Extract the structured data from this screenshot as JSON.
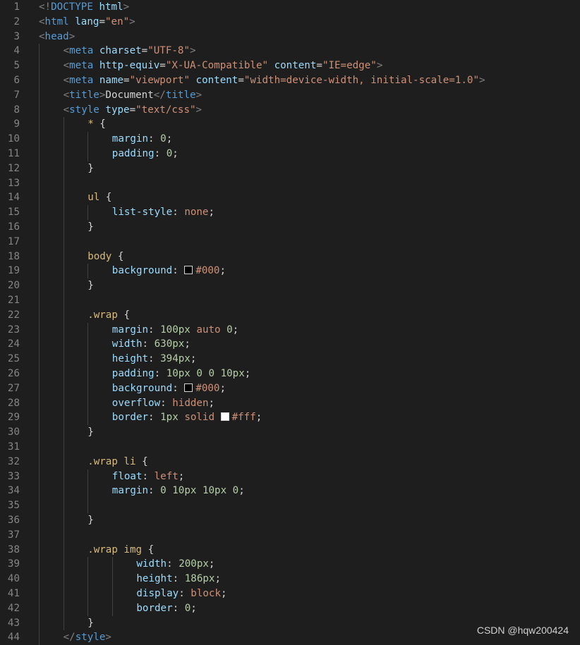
{
  "editor": {
    "lines": [
      {
        "n": "1",
        "indent": 0,
        "tokens": [
          [
            "punct",
            "<!"
          ],
          [
            "tag",
            "DOCTYPE"
          ],
          [
            "text",
            " "
          ],
          [
            "attr",
            "html"
          ],
          [
            "punct",
            ">"
          ]
        ]
      },
      {
        "n": "2",
        "indent": 0,
        "tokens": [
          [
            "punct",
            "<"
          ],
          [
            "tag",
            "html"
          ],
          [
            "text",
            " "
          ],
          [
            "attr",
            "lang"
          ],
          [
            "text",
            "="
          ],
          [
            "str",
            "\"en\""
          ],
          [
            "punct",
            ">"
          ]
        ]
      },
      {
        "n": "3",
        "indent": 0,
        "tokens": [
          [
            "punct",
            "<"
          ],
          [
            "tag",
            "head"
          ],
          [
            "punct",
            ">"
          ]
        ]
      },
      {
        "n": "4",
        "indent": 1,
        "tokens": [
          [
            "punct",
            "<"
          ],
          [
            "tag",
            "meta"
          ],
          [
            "text",
            " "
          ],
          [
            "attr",
            "charset"
          ],
          [
            "text",
            "="
          ],
          [
            "str",
            "\"UTF-8\""
          ],
          [
            "punct",
            ">"
          ]
        ]
      },
      {
        "n": "5",
        "indent": 1,
        "tokens": [
          [
            "punct",
            "<"
          ],
          [
            "tag",
            "meta"
          ],
          [
            "text",
            " "
          ],
          [
            "attr",
            "http-equiv"
          ],
          [
            "text",
            "="
          ],
          [
            "str",
            "\"X-UA-Compatible\""
          ],
          [
            "text",
            " "
          ],
          [
            "attr",
            "content"
          ],
          [
            "text",
            "="
          ],
          [
            "str",
            "\"IE=edge\""
          ],
          [
            "punct",
            ">"
          ]
        ]
      },
      {
        "n": "6",
        "indent": 1,
        "tokens": [
          [
            "punct",
            "<"
          ],
          [
            "tag",
            "meta"
          ],
          [
            "text",
            " "
          ],
          [
            "attr",
            "name"
          ],
          [
            "text",
            "="
          ],
          [
            "str",
            "\"viewport\""
          ],
          [
            "text",
            " "
          ],
          [
            "attr",
            "content"
          ],
          [
            "text",
            "="
          ],
          [
            "str",
            "\"width=device-width, initial-scale=1.0\""
          ],
          [
            "punct",
            ">"
          ]
        ]
      },
      {
        "n": "7",
        "indent": 1,
        "tokens": [
          [
            "punct",
            "<"
          ],
          [
            "tag",
            "title"
          ],
          [
            "punct",
            ">"
          ],
          [
            "text",
            "Document"
          ],
          [
            "punct",
            "</"
          ],
          [
            "tag",
            "title"
          ],
          [
            "punct",
            ">"
          ]
        ]
      },
      {
        "n": "8",
        "indent": 1,
        "tokens": [
          [
            "punct",
            "<"
          ],
          [
            "tag",
            "style"
          ],
          [
            "text",
            " "
          ],
          [
            "attr",
            "type"
          ],
          [
            "text",
            "="
          ],
          [
            "str",
            "\"text/css\""
          ],
          [
            "punct",
            ">"
          ]
        ]
      },
      {
        "n": "9",
        "indent": 2,
        "tokens": [
          [
            "sel",
            "*"
          ],
          [
            "text",
            " {"
          ]
        ]
      },
      {
        "n": "10",
        "indent": 3,
        "tokens": [
          [
            "prop",
            "margin"
          ],
          [
            "text",
            ": "
          ],
          [
            "num",
            "0"
          ],
          [
            "text",
            ";"
          ]
        ]
      },
      {
        "n": "11",
        "indent": 3,
        "tokens": [
          [
            "prop",
            "padding"
          ],
          [
            "text",
            ": "
          ],
          [
            "num",
            "0"
          ],
          [
            "text",
            ";"
          ]
        ]
      },
      {
        "n": "12",
        "indent": 2,
        "tokens": [
          [
            "text",
            "}"
          ]
        ]
      },
      {
        "n": "13",
        "indent": 0,
        "tokens": []
      },
      {
        "n": "14",
        "indent": 2,
        "tokens": [
          [
            "sel",
            "ul"
          ],
          [
            "text",
            " {"
          ]
        ]
      },
      {
        "n": "15",
        "indent": 3,
        "tokens": [
          [
            "prop",
            "list-style"
          ],
          [
            "text",
            ": "
          ],
          [
            "kw",
            "none"
          ],
          [
            "text",
            ";"
          ]
        ]
      },
      {
        "n": "16",
        "indent": 2,
        "tokens": [
          [
            "text",
            "}"
          ]
        ]
      },
      {
        "n": "17",
        "indent": 0,
        "tokens": []
      },
      {
        "n": "18",
        "indent": 2,
        "tokens": [
          [
            "sel",
            "body"
          ],
          [
            "text",
            " {"
          ]
        ]
      },
      {
        "n": "19",
        "indent": 3,
        "tokens": [
          [
            "prop",
            "background"
          ],
          [
            "text",
            ": "
          ],
          [
            "swatch",
            "#000000"
          ],
          [
            "kw",
            "#000"
          ],
          [
            "text",
            ";"
          ]
        ]
      },
      {
        "n": "20",
        "indent": 2,
        "tokens": [
          [
            "text",
            "}"
          ]
        ]
      },
      {
        "n": "21",
        "indent": 0,
        "tokens": []
      },
      {
        "n": "22",
        "indent": 2,
        "tokens": [
          [
            "sel",
            ".wrap"
          ],
          [
            "text",
            " {"
          ]
        ]
      },
      {
        "n": "23",
        "indent": 3,
        "tokens": [
          [
            "prop",
            "margin"
          ],
          [
            "text",
            ": "
          ],
          [
            "num",
            "100px"
          ],
          [
            "text",
            " "
          ],
          [
            "kw",
            "auto"
          ],
          [
            "text",
            " "
          ],
          [
            "num",
            "0"
          ],
          [
            "text",
            ";"
          ]
        ]
      },
      {
        "n": "24",
        "indent": 3,
        "tokens": [
          [
            "prop",
            "width"
          ],
          [
            "text",
            ": "
          ],
          [
            "num",
            "630px"
          ],
          [
            "text",
            ";"
          ]
        ]
      },
      {
        "n": "25",
        "indent": 3,
        "tokens": [
          [
            "prop",
            "height"
          ],
          [
            "text",
            ": "
          ],
          [
            "num",
            "394px"
          ],
          [
            "text",
            ";"
          ]
        ]
      },
      {
        "n": "26",
        "indent": 3,
        "tokens": [
          [
            "prop",
            "padding"
          ],
          [
            "text",
            ": "
          ],
          [
            "num",
            "10px"
          ],
          [
            "text",
            " "
          ],
          [
            "num",
            "0"
          ],
          [
            "text",
            " "
          ],
          [
            "num",
            "0"
          ],
          [
            "text",
            " "
          ],
          [
            "num",
            "10px"
          ],
          [
            "text",
            ";"
          ]
        ]
      },
      {
        "n": "27",
        "indent": 3,
        "tokens": [
          [
            "prop",
            "background"
          ],
          [
            "text",
            ": "
          ],
          [
            "swatch",
            "#000000"
          ],
          [
            "kw",
            "#000"
          ],
          [
            "text",
            ";"
          ]
        ]
      },
      {
        "n": "28",
        "indent": 3,
        "tokens": [
          [
            "prop",
            "overflow"
          ],
          [
            "text",
            ": "
          ],
          [
            "kw",
            "hidden"
          ],
          [
            "text",
            ";"
          ]
        ]
      },
      {
        "n": "29",
        "indent": 3,
        "tokens": [
          [
            "prop",
            "border"
          ],
          [
            "text",
            ": "
          ],
          [
            "num",
            "1px"
          ],
          [
            "text",
            " "
          ],
          [
            "kw",
            "solid"
          ],
          [
            "text",
            " "
          ],
          [
            "swatch",
            "#ffffff"
          ],
          [
            "kw",
            "#fff"
          ],
          [
            "text",
            ";"
          ]
        ]
      },
      {
        "n": "30",
        "indent": 2,
        "tokens": [
          [
            "text",
            "}"
          ]
        ]
      },
      {
        "n": "31",
        "indent": 0,
        "tokens": []
      },
      {
        "n": "32",
        "indent": 2,
        "tokens": [
          [
            "sel",
            ".wrap li"
          ],
          [
            "text",
            " {"
          ]
        ]
      },
      {
        "n": "33",
        "indent": 3,
        "tokens": [
          [
            "prop",
            "float"
          ],
          [
            "text",
            ": "
          ],
          [
            "kw",
            "left"
          ],
          [
            "text",
            ";"
          ]
        ]
      },
      {
        "n": "34",
        "indent": 3,
        "tokens": [
          [
            "prop",
            "margin"
          ],
          [
            "text",
            ": "
          ],
          [
            "num",
            "0"
          ],
          [
            "text",
            " "
          ],
          [
            "num",
            "10px"
          ],
          [
            "text",
            " "
          ],
          [
            "num",
            "10px"
          ],
          [
            "text",
            " "
          ],
          [
            "num",
            "0"
          ],
          [
            "text",
            ";"
          ]
        ]
      },
      {
        "n": "35",
        "indent": 3,
        "tokens": []
      },
      {
        "n": "36",
        "indent": 2,
        "tokens": [
          [
            "text",
            "}"
          ]
        ]
      },
      {
        "n": "37",
        "indent": 0,
        "tokens": []
      },
      {
        "n": "38",
        "indent": 2,
        "tokens": [
          [
            "sel",
            ".wrap img"
          ],
          [
            "text",
            " {"
          ]
        ]
      },
      {
        "n": "39",
        "indent": 4,
        "tokens": [
          [
            "prop",
            "width"
          ],
          [
            "text",
            ": "
          ],
          [
            "num",
            "200px"
          ],
          [
            "text",
            ";"
          ]
        ]
      },
      {
        "n": "40",
        "indent": 4,
        "tokens": [
          [
            "prop",
            "height"
          ],
          [
            "text",
            ": "
          ],
          [
            "num",
            "186px"
          ],
          [
            "text",
            ";"
          ]
        ]
      },
      {
        "n": "41",
        "indent": 4,
        "tokens": [
          [
            "prop",
            "display"
          ],
          [
            "text",
            ": "
          ],
          [
            "kw",
            "block"
          ],
          [
            "text",
            ";"
          ]
        ]
      },
      {
        "n": "42",
        "indent": 4,
        "tokens": [
          [
            "prop",
            "border"
          ],
          [
            "text",
            ": "
          ],
          [
            "num",
            "0"
          ],
          [
            "text",
            ";"
          ]
        ]
      },
      {
        "n": "43",
        "indent": 2,
        "tokens": [
          [
            "text",
            "}"
          ]
        ]
      },
      {
        "n": "44",
        "indent": 1,
        "tokens": [
          [
            "punct",
            "</"
          ],
          [
            "tag",
            "style"
          ],
          [
            "punct",
            ">"
          ]
        ]
      }
    ]
  },
  "watermark": "CSDN @hqw200424"
}
